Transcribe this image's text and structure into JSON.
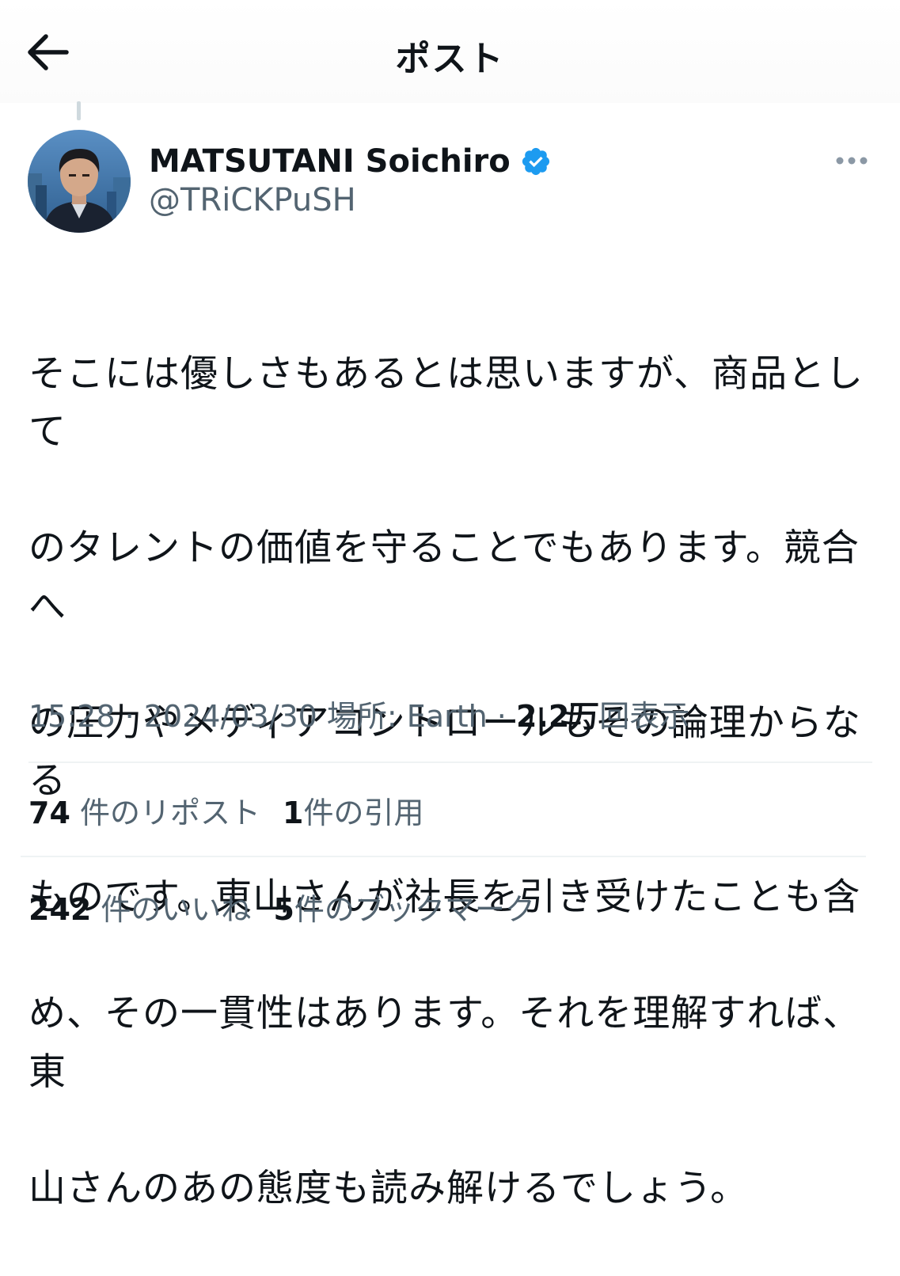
{
  "header": {
    "title": "ポスト",
    "back_icon": "arrow-left-icon"
  },
  "author": {
    "display_name": "MATSUTANI Soichiro",
    "handle": "@TRiCKPuSH",
    "verified_color": "#1d9bf0"
  },
  "post": {
    "text": "そこには優しさもあるとは思いますが、商品としての\nタレントの価値を守ることでもあります。競合への圧\n力やメディアコントロールもその論理からなるもので\nす。東山さんが社長を引き受けたことも含め、その一\n貫性はあります。それを理解すれば、東山さんのあの\n態度も読み解けるでしょう。",
    "lines": [
      "そこには優しさもあるとは思いますが、商品として",
      "のタレントの価値を守ることでもあります。競合へ",
      "の圧力やメディアコントロールもその論理からなる",
      "ものです。東山さんが社長を引き受けたことも含",
      "め、その一貫性はあります。それを理解すれば、東",
      "山さんのあの態度も読み解けるでしょう。"
    ]
  },
  "meta": {
    "time": "15:28",
    "date": "2024/03/30",
    "location_label": "場所: Earth",
    "views_count": "2.2万",
    "views_label": "回表示"
  },
  "stats": {
    "reposts_count": "74",
    "reposts_label": "件のリポスト",
    "quotes_count": "1",
    "quotes_label": "件の引用",
    "likes_count": "242",
    "likes_label": "件のいいね",
    "bookmarks_count": "5",
    "bookmarks_label": "件のブックマーク"
  }
}
